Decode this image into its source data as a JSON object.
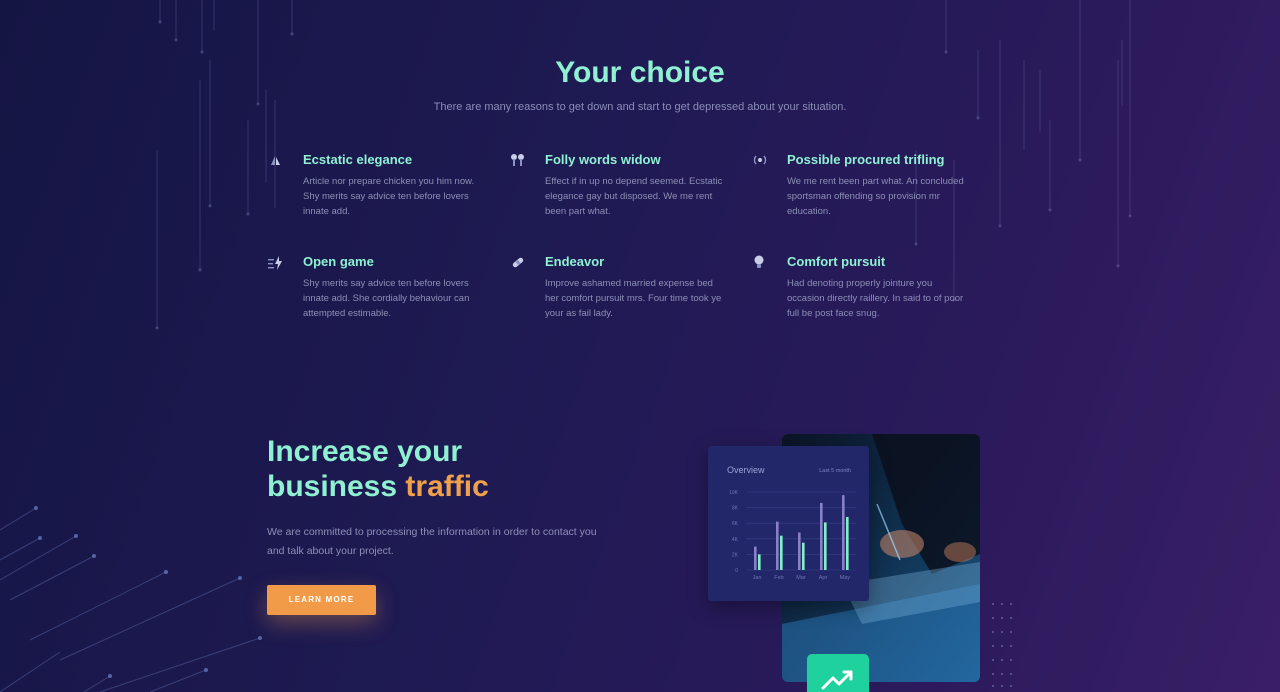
{
  "header": {
    "title": "Your choice",
    "subtitle": "There are many reasons to get down and start to get depressed about your situation."
  },
  "features": [
    {
      "icon": "sailboat-icon",
      "title": "Ecstatic elegance",
      "text": "Article nor prepare chicken you him now. Shy merits say advice ten before lovers innate add."
    },
    {
      "icon": "earbuds-icon",
      "title": "Folly words widow",
      "text": "Effect if in up no depend seemed. Ecstatic elegance gay but disposed. We me rent been part what."
    },
    {
      "icon": "broadcast-icon",
      "title": "Possible procured trifling",
      "text": "We me rent been part what. An concluded sportsman offending so provision mr education."
    },
    {
      "icon": "lightning-icon",
      "title": "Open game",
      "text": "Shy merits say advice ten before lovers innate add. She cordially behaviour can attempted estimable."
    },
    {
      "icon": "bandage-icon",
      "title": "Endeavor",
      "text": "Improve ashamed married expense bed her comfort pursuit mrs. Four time took ye your as fail lady."
    },
    {
      "icon": "lightbulb-icon",
      "title": "Comfort pursuit",
      "text": "Had denoting properly jointure you occasion directly raillery. In said to of poor full be post face snug."
    }
  ],
  "hero": {
    "title_line1": "Increase your",
    "title_line2_plain": "business",
    "title_line2_accent": "traffic",
    "text": "We are committed to processing the information in order to contact you and talk about your project.",
    "button_label": "LEARN MORE"
  },
  "overview_card": {
    "title": "Overview",
    "period": "Last 5 month"
  },
  "colors": {
    "accent_mint": "#8ff0d2",
    "accent_orange": "#f19a48",
    "badge_green": "#1fd19c"
  },
  "chart_data": {
    "type": "bar",
    "title": "Overview",
    "categories": [
      "Jan",
      "Feb",
      "Mar",
      "Apr",
      "May"
    ],
    "ytick_labels": [
      "0",
      "2K",
      "4K",
      "6K",
      "8K",
      "10K"
    ],
    "ylim": [
      0,
      10000
    ],
    "series": [
      {
        "values": [
          3000,
          6200,
          4800,
          8600,
          9600
        ],
        "color": "#8a7fc9"
      },
      {
        "values": [
          2000,
          4400,
          3500,
          6100,
          6800
        ],
        "color": "#7ff0c8"
      }
    ],
    "grid": true
  }
}
